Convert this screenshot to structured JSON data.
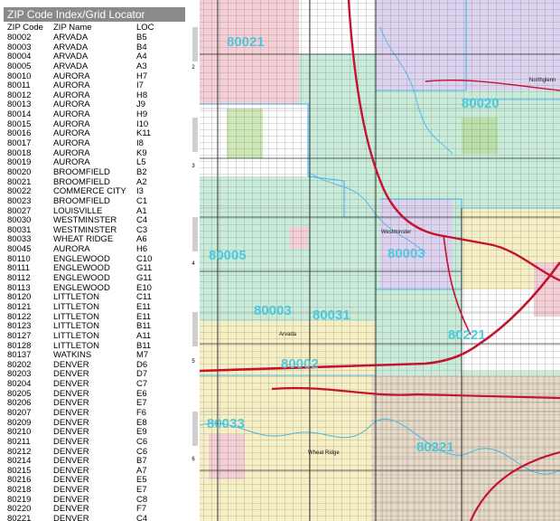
{
  "index": {
    "title": "ZIP Code Index/Grid Locator",
    "columns": [
      "ZIP Code",
      "ZIP Name",
      "LOC"
    ],
    "rows": [
      [
        "80002",
        "ARVADA",
        "B5"
      ],
      [
        "80003",
        "ARVADA",
        "B4"
      ],
      [
        "80004",
        "ARVADA",
        "A4"
      ],
      [
        "80005",
        "ARVADA",
        "A3"
      ],
      [
        "80010",
        "AURORA",
        "H7"
      ],
      [
        "80011",
        "AURORA",
        "I7"
      ],
      [
        "80012",
        "AURORA",
        "H8"
      ],
      [
        "80013",
        "AURORA",
        "J9"
      ],
      [
        "80014",
        "AURORA",
        "H9"
      ],
      [
        "80015",
        "AURORA",
        "I10"
      ],
      [
        "80016",
        "AURORA",
        "K11"
      ],
      [
        "80017",
        "AURORA",
        "I8"
      ],
      [
        "80018",
        "AURORA",
        "K9"
      ],
      [
        "80019",
        "AURORA",
        "L5"
      ],
      [
        "80020",
        "BROOMFIELD",
        "B2"
      ],
      [
        "80021",
        "BROOMFIELD",
        "A2"
      ],
      [
        "80022",
        "COMMERCE CITY",
        "I3"
      ],
      [
        "80023",
        "BROOMFIELD",
        "C1"
      ],
      [
        "80027",
        "LOUISVILLE",
        "A1"
      ],
      [
        "80030",
        "WESTMINSTER",
        "C4"
      ],
      [
        "80031",
        "WESTMINSTER",
        "C3"
      ],
      [
        "80033",
        "WHEAT RIDGE",
        "A6"
      ],
      [
        "80045",
        "AURORA",
        "H6"
      ],
      [
        "80110",
        "ENGLEWOOD",
        "C10"
      ],
      [
        "80111",
        "ENGLEWOOD",
        "G11"
      ],
      [
        "80112",
        "ENGLEWOOD",
        "G11"
      ],
      [
        "80113",
        "ENGLEWOOD",
        "E10"
      ],
      [
        "80120",
        "LITTLETON",
        "C11"
      ],
      [
        "80121",
        "LITTLETON",
        "E11"
      ],
      [
        "80122",
        "LITTLETON",
        "E11"
      ],
      [
        "80123",
        "LITTLETON",
        "B11"
      ],
      [
        "80127",
        "LITTLETON",
        "A11"
      ],
      [
        "80128",
        "LITTLETON",
        "B11"
      ],
      [
        "80137",
        "WATKINS",
        "M7"
      ],
      [
        "80202",
        "DENVER",
        "D6"
      ],
      [
        "80203",
        "DENVER",
        "D7"
      ],
      [
        "80204",
        "DENVER",
        "C7"
      ],
      [
        "80205",
        "DENVER",
        "E6"
      ],
      [
        "80206",
        "DENVER",
        "E7"
      ],
      [
        "80207",
        "DENVER",
        "F6"
      ],
      [
        "80209",
        "DENVER",
        "E8"
      ],
      [
        "80210",
        "DENVER",
        "E9"
      ],
      [
        "80211",
        "DENVER",
        "C6"
      ],
      [
        "80212",
        "DENVER",
        "C6"
      ],
      [
        "80214",
        "DENVER",
        "B7"
      ],
      [
        "80215",
        "DENVER",
        "A7"
      ],
      [
        "80216",
        "DENVER",
        "E5"
      ],
      [
        "80218",
        "DENVER",
        "E7"
      ],
      [
        "80219",
        "DENVER",
        "C8"
      ],
      [
        "80220",
        "DENVER",
        "F7"
      ],
      [
        "80221",
        "DENVER",
        "C4"
      ]
    ]
  },
  "grid_numbers": [
    "2",
    "3",
    "4",
    "5",
    "6"
  ],
  "map": {
    "zip_labels": [
      "80021",
      "80020",
      "80005",
      "80003",
      "80003",
      "80221",
      "80002",
      "80033",
      "80031",
      "80221"
    ],
    "place_labels": [
      "Westminster",
      "Arvada",
      "Northglenn",
      "Wheat Ridge"
    ]
  },
  "colors": {
    "header_bg": "#8a8a8a",
    "zip_label": "#3fc6e0",
    "highway": "#c4122f",
    "water": "#4ab6e6",
    "zone_green": "#c8ecd9",
    "zone_pink": "#f4cfd6",
    "zone_purple": "#ddd3f0",
    "zone_yellow": "#f6efc4",
    "zone_tan": "#e8dcc9"
  }
}
